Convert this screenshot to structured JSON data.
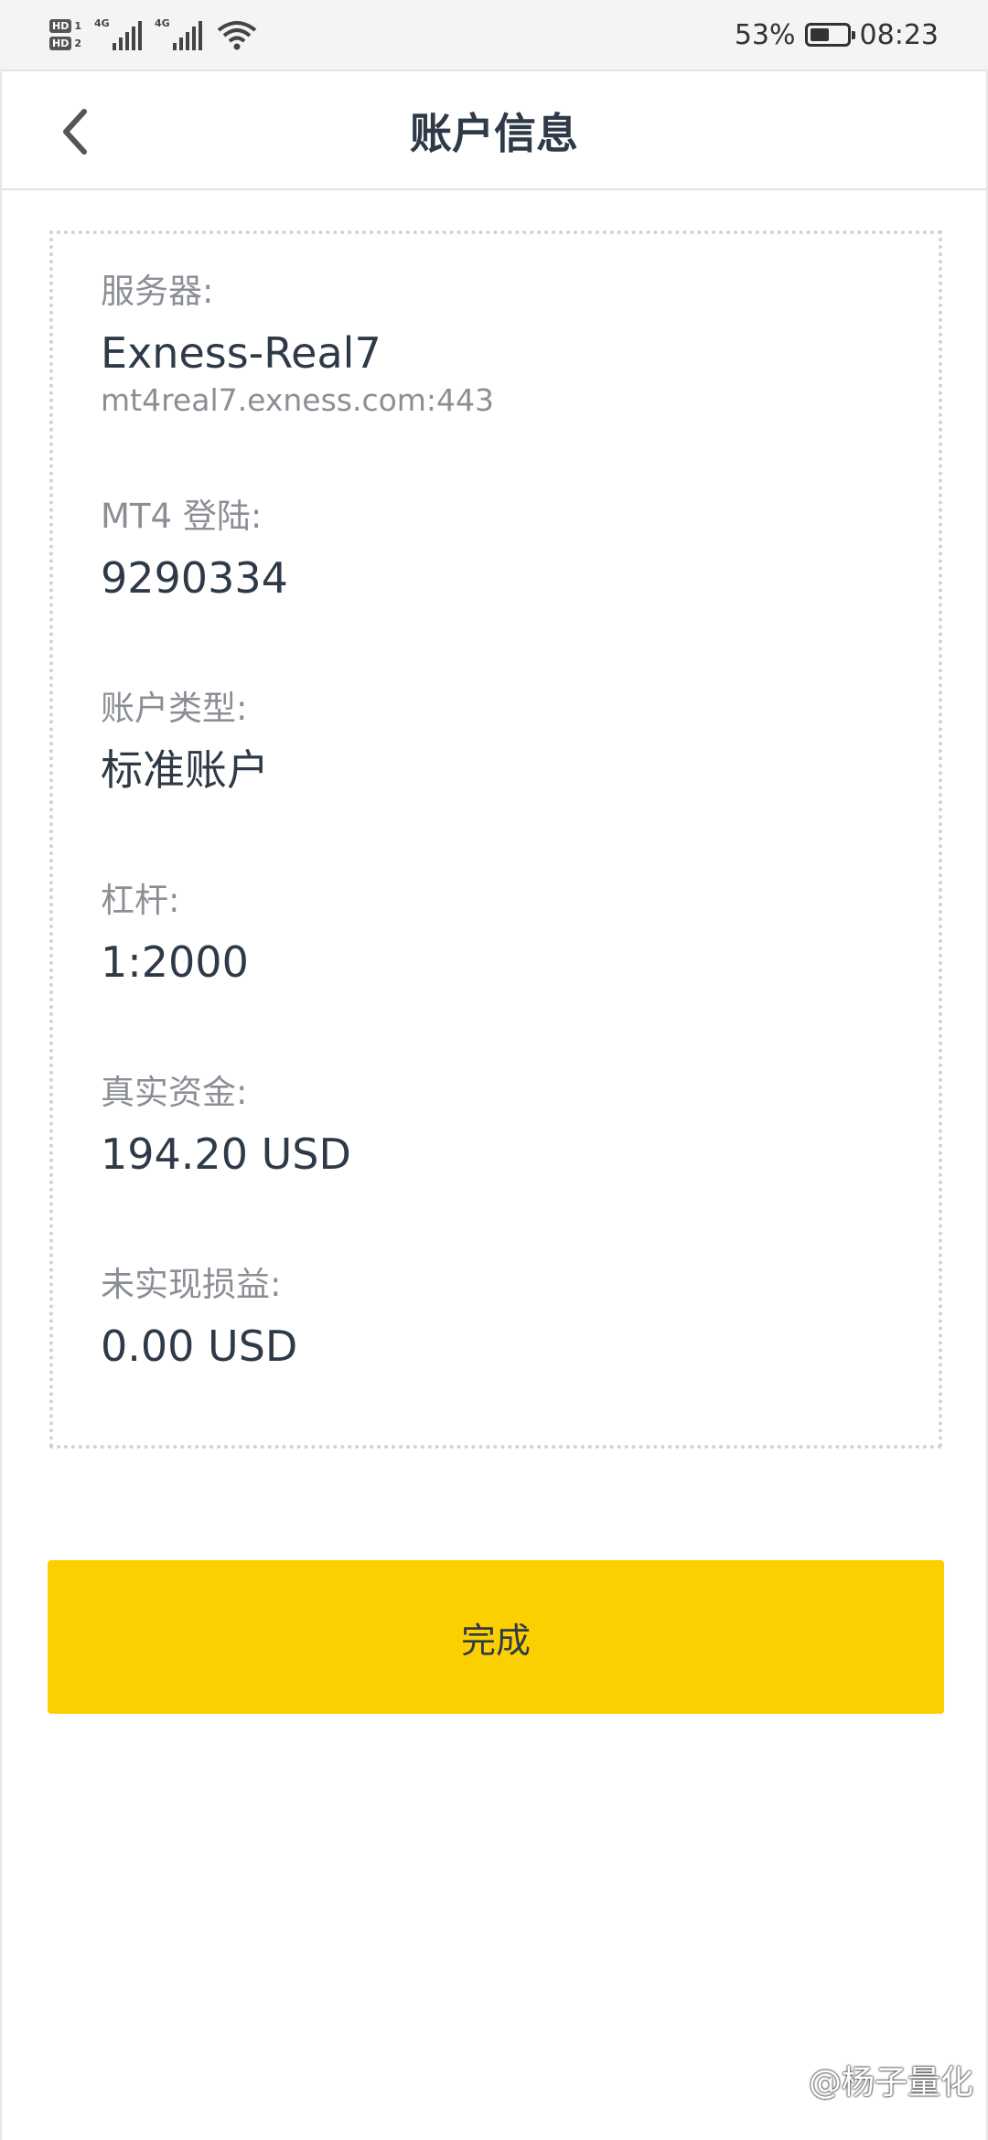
{
  "status_bar": {
    "sim1": "HD 1",
    "sim2": "HD 2",
    "network1": "4G",
    "network2": "4G",
    "battery_percent_text": "53%",
    "battery_level": 0.53,
    "time": "08:23",
    "icons": [
      "hd-icon",
      "signal-icon",
      "wifi-icon",
      "battery-icon"
    ]
  },
  "header": {
    "title": "账户信息",
    "back_icon": "chevron-left-icon"
  },
  "account": {
    "server_label": "服务器:",
    "server_value": "Exness-Real7",
    "server_address": "mt4real7.exness.com:443",
    "login_label": "MT4 登陆:",
    "login_value": "9290334",
    "type_label": "账户类型:",
    "type_value": "标准账户",
    "leverage_label": "杠杆:",
    "leverage_value": "1:2000",
    "equity_label": "真实资金:",
    "equity_value": "194.20 USD",
    "pnl_label": "未实现损益:",
    "pnl_value": "0.00 USD"
  },
  "actions": {
    "done_label": "完成"
  },
  "watermark": {
    "text": "@杨子量化"
  },
  "colors": {
    "accent": "#fcd000",
    "text_primary": "#2f3a48",
    "text_secondary": "#8b8f95"
  }
}
